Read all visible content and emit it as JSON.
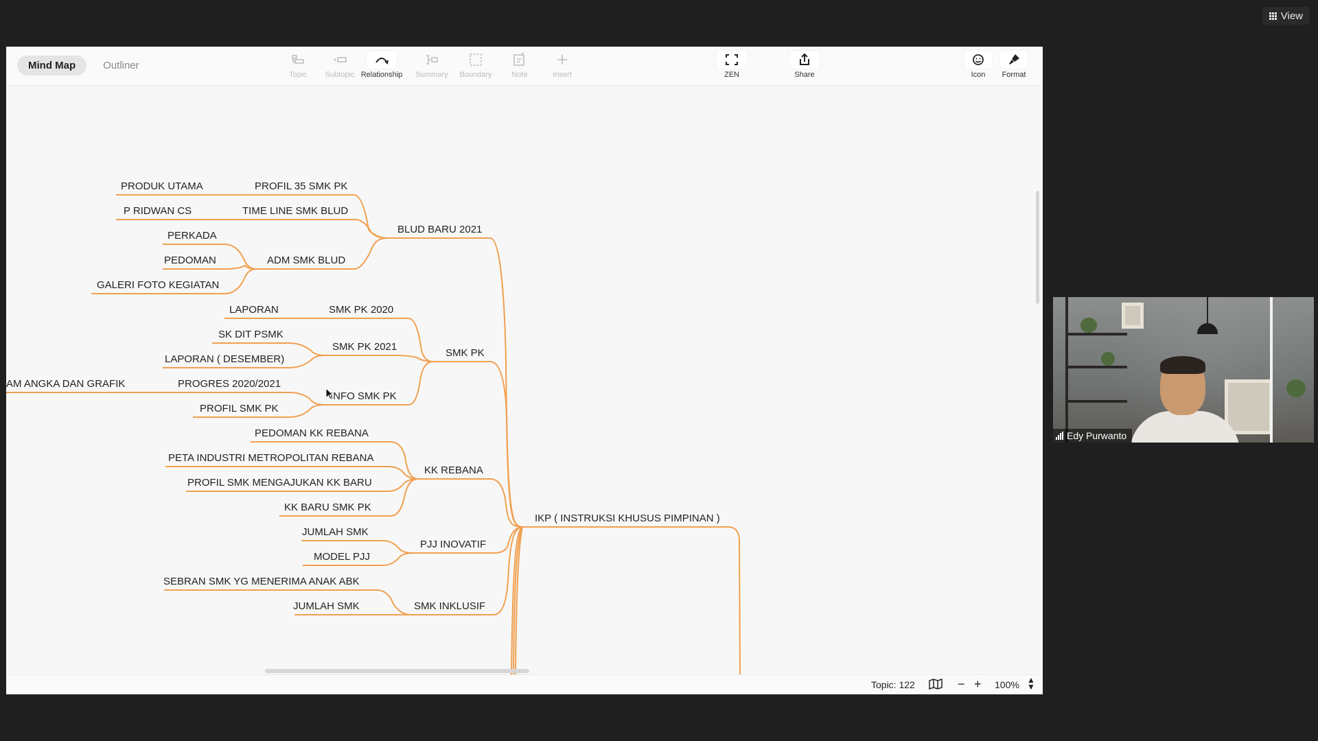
{
  "window": {
    "view_label": "View"
  },
  "toolbar": {
    "tabs": [
      {
        "label": "Mind Map",
        "active": true
      },
      {
        "label": "Outliner",
        "active": false
      }
    ],
    "tools": {
      "topic": "Topic",
      "subtopic": "Subtopic",
      "relationship": "Relationship",
      "summary": "Summary",
      "boundary": "Boundary",
      "note": "Note",
      "insert": "Insert",
      "zen": "ZEN",
      "share": "Share",
      "icon": "Icon",
      "format": "Format"
    }
  },
  "mindmap": {
    "line_color": "#f0a050",
    "central": "IKP ( INSTRUKSI KHUSUS PIMPINAN )",
    "branches": [
      {
        "label": "BLUD  BARU 2021",
        "children": [
          {
            "label": "PROFIL 35 SMK PK",
            "children": [
              {
                "label": "PRODUK UTAMA"
              }
            ]
          },
          {
            "label": "TIME LINE SMK BLUD",
            "children": [
              {
                "label": "P RIDWAN CS"
              }
            ]
          },
          {
            "label": "ADM SMK BLUD",
            "children": [
              {
                "label": "PERKADA"
              },
              {
                "label": "PEDOMAN"
              },
              {
                "label": "GALERI FOTO KEGIATAN"
              }
            ]
          }
        ]
      },
      {
        "label": "SMK PK",
        "children": [
          {
            "label": "SMK PK 2020",
            "children": [
              {
                "label": "LAPORAN"
              }
            ]
          },
          {
            "label": "SMK PK 2021",
            "children": [
              {
                "label": "SK DIT PSMK"
              },
              {
                "label": "LAPORAN ( DESEMBER)"
              }
            ]
          },
          {
            "label": "INFO SMK PK",
            "children": [
              {
                "label": "PROGRES 2020/2021",
                "children": [
                  {
                    "label": "AM ANGKA DAN GRAFIK"
                  }
                ]
              },
              {
                "label": "PROFIL SMK PK"
              }
            ]
          }
        ]
      },
      {
        "label": "KK REBANA",
        "children": [
          {
            "label": "PEDOMAN KK REBANA"
          },
          {
            "label": "PETA INDUSTRI METROPOLITAN REBANA"
          },
          {
            "label": "PROFIL SMK MENGAJUKAN KK BARU"
          },
          {
            "label": "KK BARU SMK PK"
          }
        ]
      },
      {
        "label": "PJJ INOVATIF",
        "children": [
          {
            "label": "JUMLAH SMK"
          },
          {
            "label": "MODEL PJJ"
          }
        ]
      },
      {
        "label": "SMK INKLUSIF",
        "children": [
          {
            "label": "SEBRAN SMK YG MENERIMA ANAK ABK"
          },
          {
            "label": "JUMLAH SMK"
          }
        ]
      }
    ]
  },
  "status": {
    "topic_count": "Topic: 122",
    "zoom": "100%",
    "zoom_minus": "−",
    "zoom_plus": "+"
  },
  "video": {
    "participant_name": "Edy Purwanto"
  }
}
